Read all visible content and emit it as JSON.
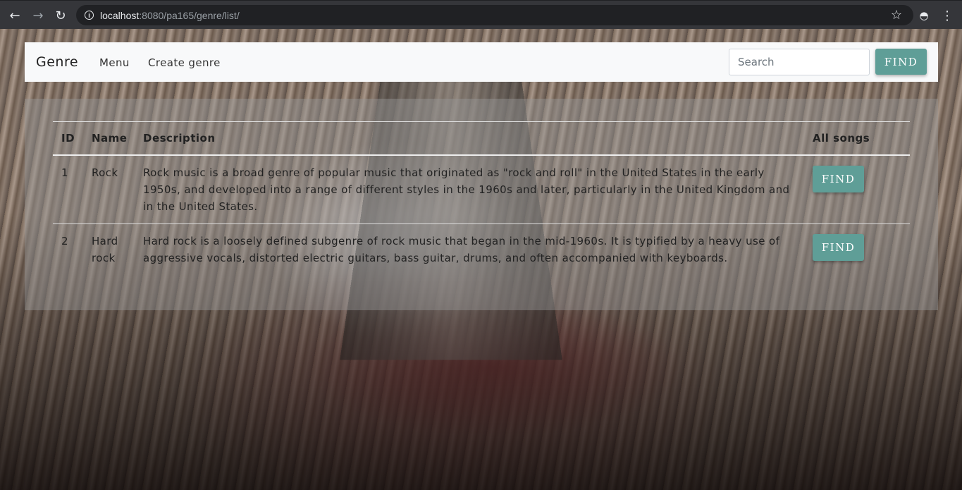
{
  "browser": {
    "url_host": "localhost",
    "url_rest": ":8080/pa165/genre/list/"
  },
  "navbar": {
    "brand": "Genre",
    "links": [
      "Menu",
      "Create genre"
    ],
    "search_placeholder": "Search",
    "find_label": "FIND"
  },
  "table": {
    "headers": {
      "id": "ID",
      "name": "Name",
      "description": "Description",
      "songs": "All songs"
    },
    "rows": [
      {
        "id": "1",
        "name": "Rock",
        "description": "Rock music is a broad genre of popular music that originated as \"rock and roll\" in the United States in the early 1950s, and developed into a range of different styles in the 1960s and later, particularly in the United Kingdom and in the United States.",
        "button": "FIND"
      },
      {
        "id": "2",
        "name": "Hard rock",
        "description": "Hard rock is a loosely defined subgenre of rock music that began in the mid-1960s. It is typified by a heavy use of aggressive vocals, distorted electric guitars, bass guitar, drums, and often accompanied with keyboards.",
        "button": "FIND"
      }
    ]
  },
  "colors": {
    "accent": "#5f9e97"
  }
}
